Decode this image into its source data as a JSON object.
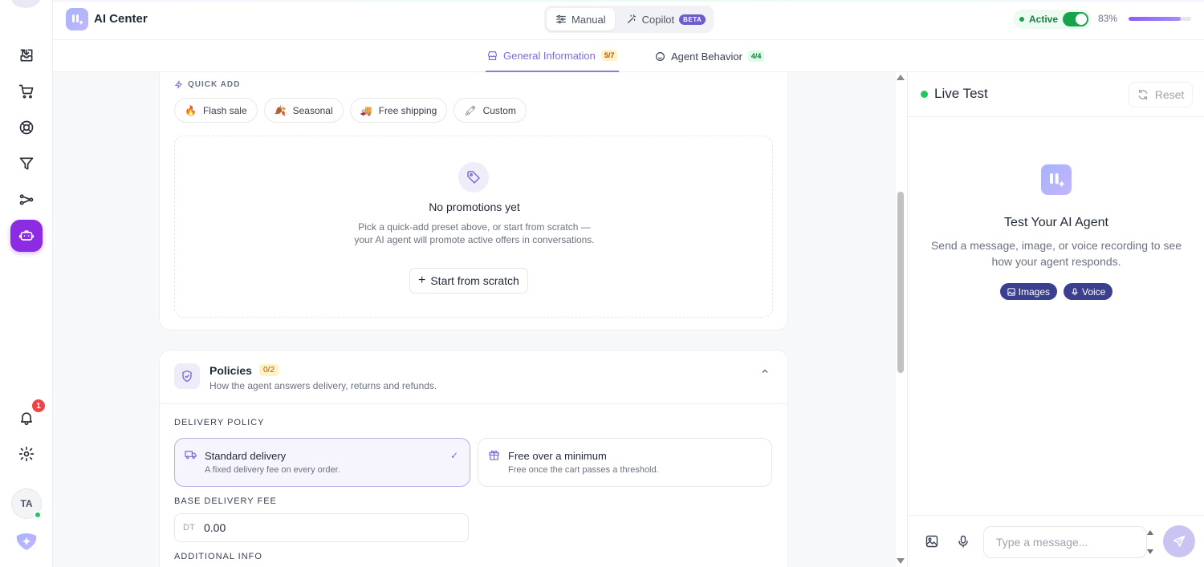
{
  "app": {
    "title": "AI Center"
  },
  "header": {
    "modes": [
      {
        "label": "Manual",
        "active": true
      },
      {
        "label": "Copilot",
        "badge": "BETA",
        "active": false
      }
    ],
    "status": {
      "label": "Active",
      "enabled": true
    },
    "completion": {
      "label": "83%",
      "value": 0.83
    }
  },
  "tabs": [
    {
      "label": "General Information",
      "count": "5/7",
      "active": true
    },
    {
      "label": "Agent Behavior",
      "count": "4/4",
      "active": false
    }
  ],
  "sidebar": {
    "items": [
      {
        "name": "inbox-icon"
      },
      {
        "name": "cart-icon"
      },
      {
        "name": "support-icon"
      },
      {
        "name": "filter-icon"
      },
      {
        "name": "flow-icon"
      },
      {
        "name": "bot-icon",
        "active": true
      },
      {
        "name": "bell-icon"
      },
      {
        "name": "gear-icon"
      }
    ],
    "notification_count": "1",
    "avatar_initials": "TA"
  },
  "promotions": {
    "quick_add_label": "QUICK ADD",
    "presets": [
      {
        "label": "Flash sale",
        "icon": "fire-icon"
      },
      {
        "label": "Seasonal",
        "icon": "leaf-icon"
      },
      {
        "label": "Free shipping",
        "icon": "truck-icon"
      },
      {
        "label": "Custom",
        "icon": "pencil-icon"
      }
    ],
    "empty_title": "No promotions yet",
    "empty_desc": "Pick a quick-add preset above, or start from scratch — your AI agent will promote active offers in conversations.",
    "start_button": "Start from scratch"
  },
  "policies": {
    "title": "Policies",
    "count": "0/2",
    "description": "How the agent answers delivery, returns and refunds.",
    "delivery_label": "DELIVERY POLICY",
    "options": [
      {
        "title": "Standard delivery",
        "desc": "A fixed delivery fee on every order.",
        "selected": true
      },
      {
        "title": "Free over a minimum",
        "desc": "Free once the cart passes a threshold.",
        "selected": false
      }
    ],
    "fee_label": "BASE DELIVERY FEE",
    "fee_prefix": "DT",
    "fee_value": "0.00",
    "additional_label": "ADDITIONAL INFO"
  },
  "live_test": {
    "title": "Live Test",
    "reset_label": "Reset",
    "heading": "Test Your AI Agent",
    "description": "Send a message, image, or voice recording to see how your agent responds.",
    "capabilities": [
      "Images",
      "Voice"
    ],
    "input_placeholder": "Type a message..."
  },
  "colors": {
    "accent": "#8b2be2",
    "active_green": "#16a34a",
    "tab_active": "#7c6bd6",
    "pill_bg": "#3b3f8f"
  }
}
